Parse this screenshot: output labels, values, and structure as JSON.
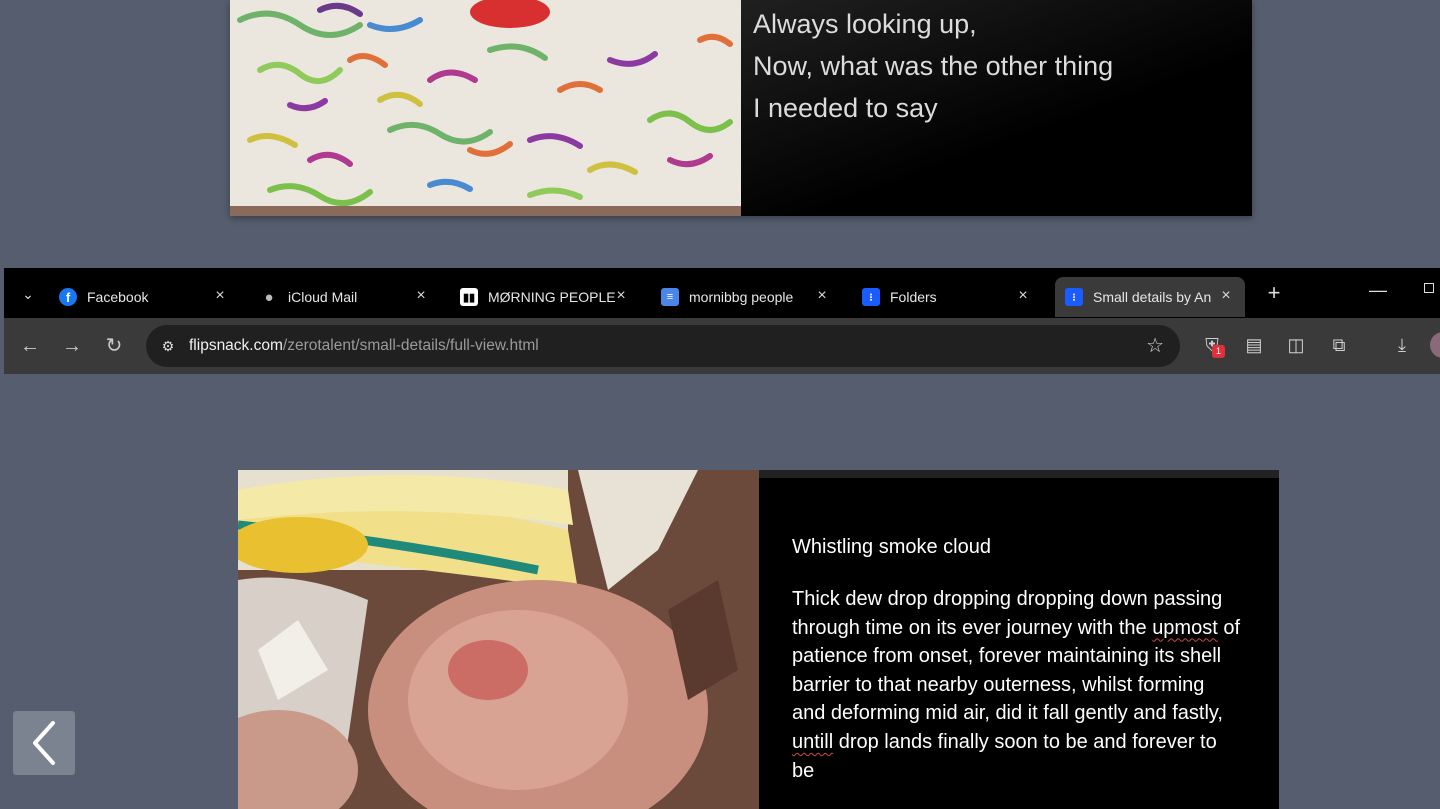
{
  "top_spread": {
    "lines": [
      "Always looking up,",
      "Now, what was the other thing",
      "I needed to say"
    ]
  },
  "browser": {
    "tabs": [
      {
        "title": "Facebook",
        "icon": "facebook-icon",
        "active": false
      },
      {
        "title": "iCloud Mail",
        "icon": "apple-icon",
        "active": false
      },
      {
        "title": "MØRNING PEOPLE",
        "icon": "morning-people-icon",
        "active": false
      },
      {
        "title": "mornibbg people",
        "icon": "docs-icon",
        "active": false
      },
      {
        "title": "Folders",
        "icon": "flipsnack-icon",
        "active": false
      },
      {
        "title": "Small details by An",
        "icon": "flipsnack-icon",
        "active": true
      }
    ],
    "url_host": "flipsnack.com",
    "url_path": "/zerotalent/small-details/full-view.html",
    "extension_badge": "1",
    "colors": {
      "tabstrip": "#000000",
      "toolbar": "#3a3a3a",
      "omnibox": "#202020"
    }
  },
  "bottom_spread": {
    "title": "Whistling smoke cloud",
    "body_parts": [
      {
        "text": "Thick dew drop dropping dropping down passing through time on its ever journey with the ",
        "misspelled": false
      },
      {
        "text": "upmost",
        "misspelled": true
      },
      {
        "text": " of patience from onset, forever maintaining its shell barrier to that nearby outerness, whilst forming and deforming mid air, did it fall gently and fastly, ",
        "misspelled": false
      },
      {
        "text": "untill",
        "misspelled": true
      },
      {
        "text": " drop lands finally soon to be and forever to be",
        "misspelled": false
      }
    ]
  },
  "viewer": {
    "background": "#555d6e",
    "prev_icon": "chevron-left-icon"
  }
}
